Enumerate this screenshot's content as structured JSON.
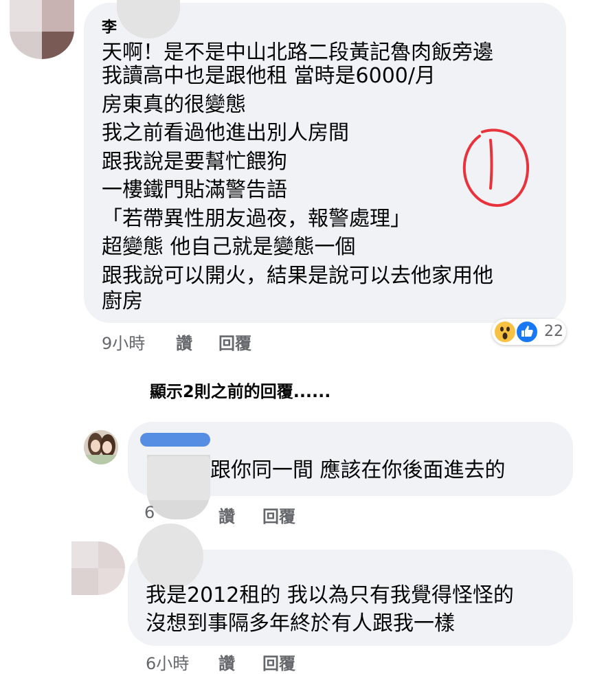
{
  "comment1": {
    "name": "李",
    "lines": [
      "天啊！是不是中山北路二段黃記魯肉飯旁邊",
      "我讀高中也是跟他租 當時是6000/月",
      "房東真的很變態",
      "我之前看過他進出別人房間",
      "跟我說是要幫忙餵狗",
      "一樓鐵門貼滿警告語",
      "「若帶異性朋友過夜，報警處理」",
      "超變態 他自己就是變態一個",
      "跟我說可以開火，結果是說可以去他家用他",
      "廚房"
    ],
    "time": "9小時",
    "like_label": "讚",
    "reply_label": "回覆",
    "reaction_count": "22",
    "reaction_icons": [
      "wow-icon",
      "like-icon"
    ],
    "annotation_color": "#e8323c"
  },
  "show_previous_replies": "顯示2則之前的回覆......",
  "reply1": {
    "name": "",
    "text": "跟你同一間 應該在你後面進去的",
    "time": "6",
    "like_label": "讚",
    "reply_label": "回覆"
  },
  "reply2": {
    "lines": [
      "我是2012租的 我以為只有我覺得怪怪的",
      "沒想到事隔多年終於有人跟我一樣"
    ],
    "time": "6小時",
    "like_label": "讚",
    "reply_label": "回覆"
  },
  "colors": {
    "bubble": "#f0f2f5",
    "meta_text": "#65676b",
    "like_blue": "#1877f2",
    "blur_name_blue": "#3b7de0"
  }
}
